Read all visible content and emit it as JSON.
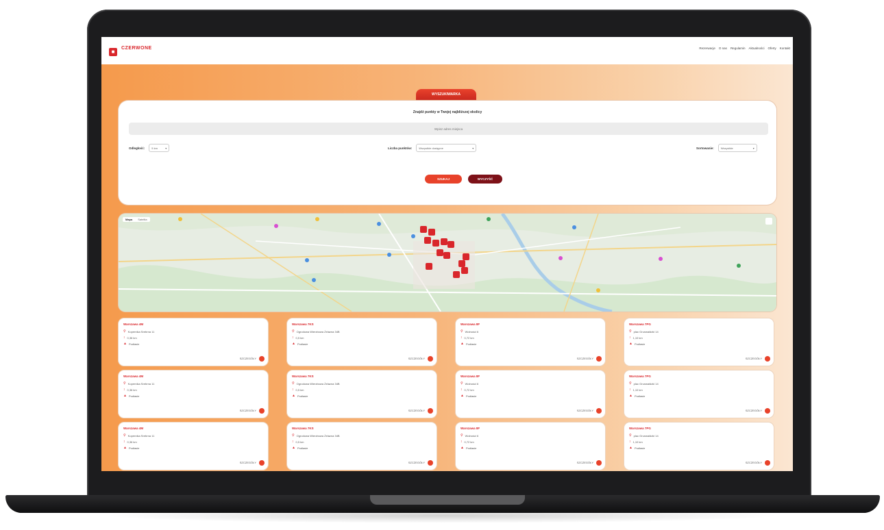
{
  "brand": {
    "logo_text": "CZERWONE"
  },
  "nav": [
    "Rezerwacje",
    "O nas",
    "Regulamin",
    "Aktualności",
    "Oferty",
    "Kontakt"
  ],
  "search": {
    "tab_label": "WYSZUKIWARKA",
    "title": "Znajdź punkty w Twojej najbliższej okolicy",
    "placeholder": "Wpisz adres miejsca",
    "filters": [
      {
        "label": "Odległość:",
        "value": "5 km"
      },
      {
        "label": "Liczba punktów:",
        "value": "Wszystkie dostępne"
      },
      {
        "label": "Sortowanie:",
        "value": "Wszystkie"
      }
    ],
    "search_button": "SZUKAJ",
    "clear_button": "WYCZYŚĆ"
  },
  "map": {
    "tabs": [
      "Mapa",
      "Satelita"
    ],
    "marker_color": "#d9262b"
  },
  "cards": [
    {
      "name": "Warszawa 4M",
      "address": "Kopernika Srebrna 11",
      "distance": "0,36 km",
      "status": "Podlasie",
      "more": "SZCZEGÓŁY"
    },
    {
      "name": "Warszawa 7KS",
      "address": "Ogrodowa Wierzbowa Żelazna 34B",
      "distance": "0,5 km",
      "status": "Podlasie",
      "more": "SZCZEGÓŁY"
    },
    {
      "name": "Warszawa 8F",
      "address": "Wolności 6",
      "distance": "0,72 km",
      "status": "Podlasie",
      "more": "SZCZEGÓŁY"
    },
    {
      "name": "Warszawa 7PG",
      "address": "plac Grunwaldzki 14",
      "distance": "1,10 km",
      "status": "Podlasie",
      "more": "SZCZEGÓŁY"
    },
    {
      "name": "Warszawa 4M",
      "address": "Kopernika Srebrna 11",
      "distance": "0,36 km",
      "status": "Podlasie",
      "more": "SZCZEGÓŁY"
    },
    {
      "name": "Warszawa 7KS",
      "address": "Ogrodowa Wierzbowa Żelazna 34B",
      "distance": "0,5 km",
      "status": "Podlasie",
      "more": "SZCZEGÓŁY"
    },
    {
      "name": "Warszawa 8F",
      "address": "Wolności 6",
      "distance": "0,72 km",
      "status": "Podlasie",
      "more": "SZCZEGÓŁY"
    },
    {
      "name": "Warszawa 7PG",
      "address": "plac Grunwaldzki 14",
      "distance": "1,10 km",
      "status": "Podlasie",
      "more": "SZCZEGÓŁY"
    },
    {
      "name": "Warszawa 4M",
      "address": "Kopernika Srebrna 11",
      "distance": "0,36 km",
      "status": "Podlasie",
      "more": "SZCZEGÓŁY"
    },
    {
      "name": "Warszawa 7KS",
      "address": "Ogrodowa Wierzbowa Żelazna 34B",
      "distance": "0,5 km",
      "status": "Podlasie",
      "more": "SZCZEGÓŁY"
    },
    {
      "name": "Warszawa 8F",
      "address": "Wolności 6",
      "distance": "0,72 km",
      "status": "Podlasie",
      "more": "SZCZEGÓŁY"
    },
    {
      "name": "Warszawa 7PG",
      "address": "plac Grunwaldzki 14",
      "distance": "1,10 km",
      "status": "Podlasie",
      "more": "SZCZEGÓŁY"
    }
  ]
}
